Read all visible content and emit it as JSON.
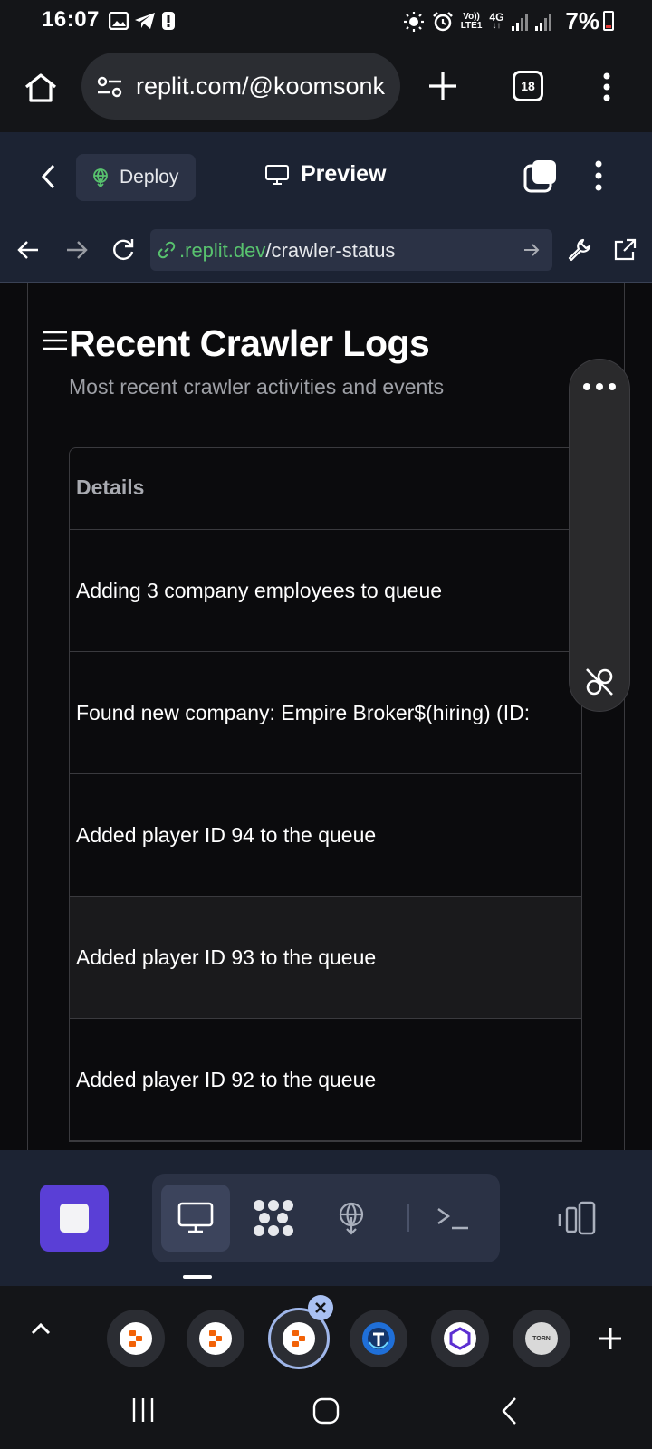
{
  "status_bar": {
    "time": "16:07",
    "network_top": "Vo))",
    "network_bottom": "LTE1",
    "network_gen": "4G",
    "battery": "7%",
    "icons": [
      "gallery-icon",
      "telegram-icon",
      "alert-icon",
      "brightness-icon",
      "alarm-icon",
      "signal-icon",
      "battery-icon"
    ]
  },
  "browser": {
    "url": "replit.com/@koomsonk",
    "tab_count": "18"
  },
  "replit_header": {
    "deploy_label": "Deploy",
    "preview_label": "Preview"
  },
  "nav": {
    "url_host": ".replit.dev",
    "url_path": "/crawler-status"
  },
  "card": {
    "title": "Recent Crawler Logs",
    "subtitle": "Most recent crawler activities and events",
    "table": {
      "header": "Details",
      "rows": [
        "Adding 3 company employees to queue",
        "Found new company: Empire Broker$(hiring) (ID:",
        "Added player ID 94 to the queue",
        "Added player ID 93 to the queue",
        "Added player ID 92 to the queue"
      ]
    }
  },
  "tabstrip": {
    "torn_label": "TORN"
  },
  "colors": {
    "accent": "#5a3fd6",
    "link_green": "#58c26e",
    "header_bg": "#1c2333",
    "surface": "#2b3245"
  }
}
